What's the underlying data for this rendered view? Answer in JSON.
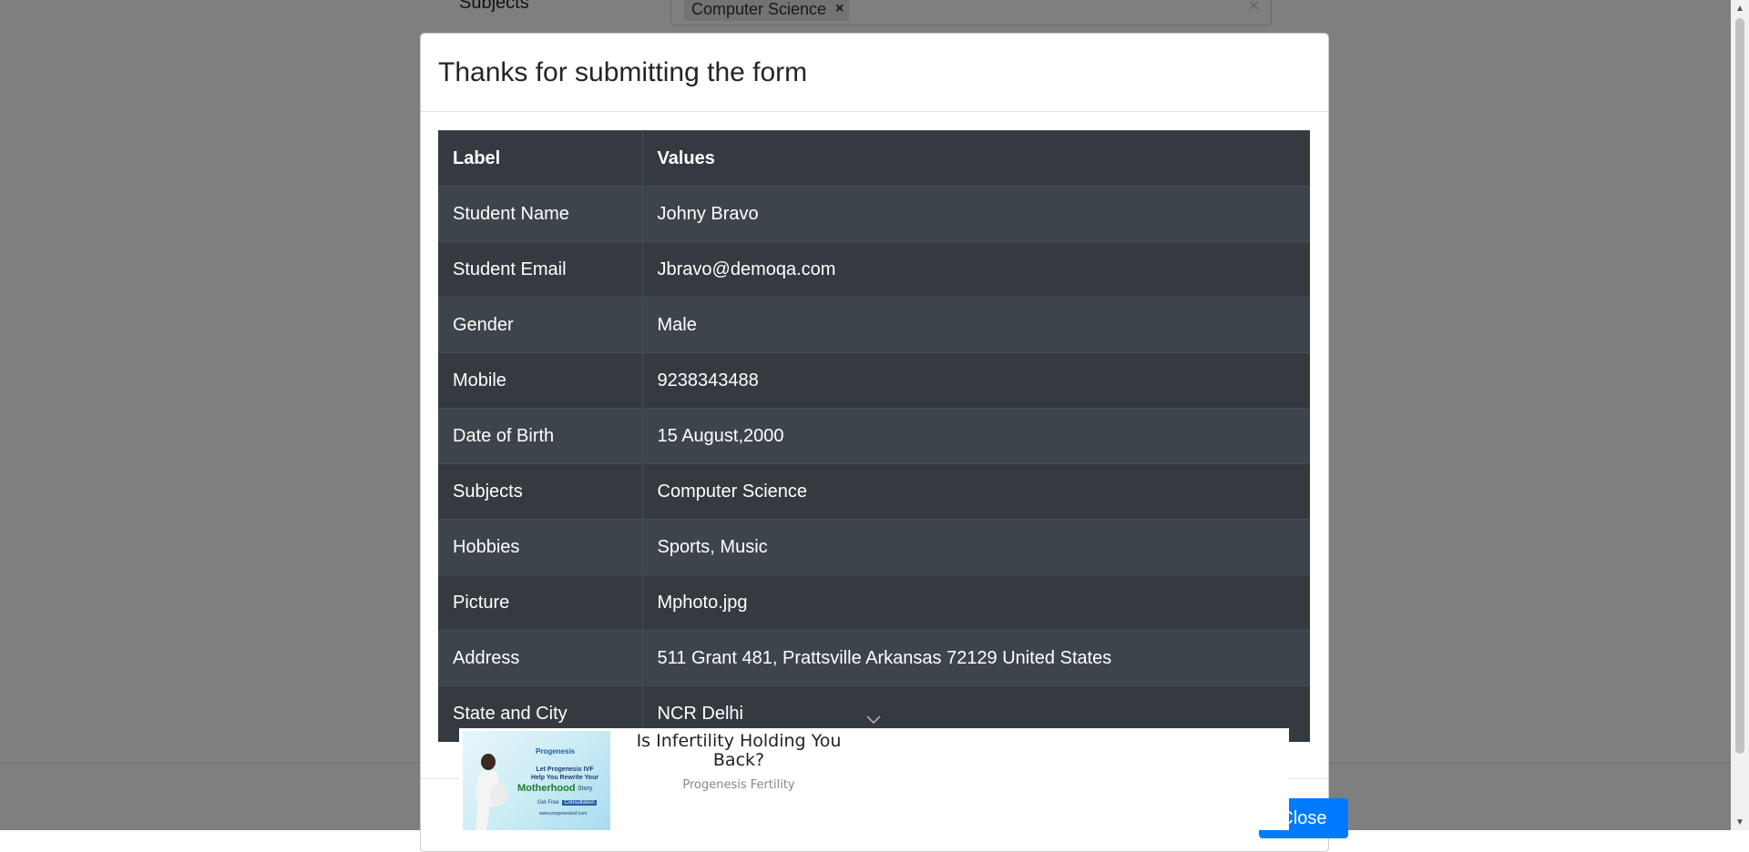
{
  "background": {
    "subjects_label": "Subjects",
    "subjects_chip": "Computer Science",
    "chip_remove_icon": "×",
    "clear_icon": "×"
  },
  "modal": {
    "title": "Thanks for submitting the form",
    "table": {
      "headers": [
        "Label",
        "Values"
      ],
      "rows": [
        {
          "label": "Student Name",
          "value": "Johny Bravo"
        },
        {
          "label": "Student Email",
          "value": "Jbravo@demoqa.com"
        },
        {
          "label": "Gender",
          "value": "Male"
        },
        {
          "label": "Mobile",
          "value": "9238343488"
        },
        {
          "label": "Date of Birth",
          "value": "15 August,2000"
        },
        {
          "label": "Subjects",
          "value": "Computer Science"
        },
        {
          "label": "Hobbies",
          "value": "Sports, Music"
        },
        {
          "label": "Picture",
          "value": "Mphoto.jpg"
        },
        {
          "label": "Address",
          "value": "511 Grant 481, Prattsville Arkansas 72129 United States"
        },
        {
          "label": "State and City",
          "value": "NCR Delhi"
        }
      ]
    },
    "close_button": "Close"
  },
  "ad": {
    "title": "Is Infertility Holding You Back?",
    "advertiser": "Progenesis Fertility",
    "image_text": {
      "logo": "Progenesis",
      "line1": "Let Progenesis IVF Help You Rewrite Your",
      "highlight": "Motherhood",
      "line2": "Story",
      "cta_prefix": "Get Free",
      "cta_button": "Consultation",
      "url": "www.progenesisivf.com"
    }
  },
  "colors": {
    "table_dark": "#343a40",
    "table_striped": "#3e444b",
    "primary": "#007bff",
    "backdrop": "rgba(0,0,0,0.5)"
  }
}
